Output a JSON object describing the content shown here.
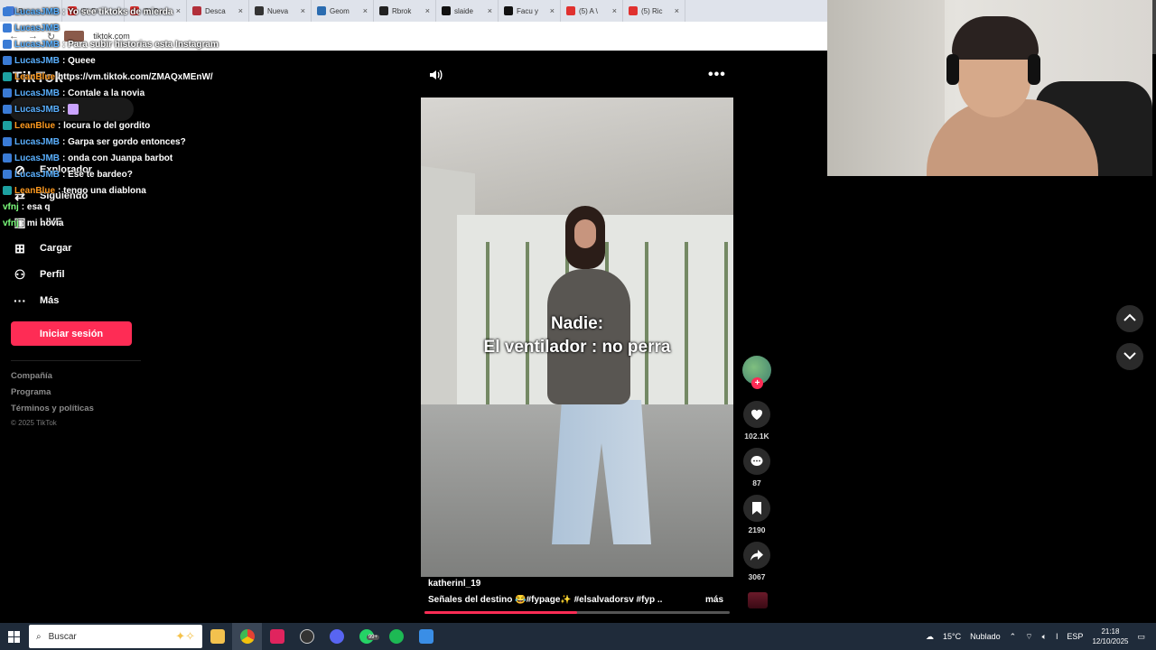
{
  "browser": {
    "tabs": [
      {
        "label": "Re",
        "color": "#4a7bd8"
      },
      {
        "label": "(5) El",
        "color": "#e0312f"
      },
      {
        "label": "(5) Pri",
        "color": "#e0312f"
      },
      {
        "label": "Desca",
        "color": "#b22f3a"
      },
      {
        "label": "Nueva",
        "color": "#333333"
      },
      {
        "label": "Geom",
        "color": "#2b6cb0"
      },
      {
        "label": "Rbrok",
        "color": "#222222"
      },
      {
        "label": "slaide",
        "color": "#111111"
      },
      {
        "label": "Facu y",
        "color": "#111111"
      },
      {
        "label": "(5) A \\",
        "color": "#e0312f"
      },
      {
        "label": "(5) Ric",
        "color": "#e0312f"
      }
    ],
    "close_glyph": "×",
    "url": "tiktok.com"
  },
  "tiktok": {
    "logo": "TikTok",
    "nav": [
      {
        "label": "Explorador",
        "icon": "compass-icon",
        "glyph": "⊘"
      },
      {
        "label": "Siguiendo",
        "icon": "following-icon",
        "glyph": "⇄"
      },
      {
        "label": "LIVE",
        "icon": "live-icon",
        "glyph": "▣"
      },
      {
        "label": "Cargar",
        "icon": "upload-icon",
        "glyph": "⊞"
      },
      {
        "label": "Perfil",
        "icon": "profile-icon",
        "glyph": "⚇"
      },
      {
        "label": "Más",
        "icon": "more-icon",
        "glyph": "···"
      }
    ],
    "login_button": "Iniciar sesión",
    "footer_links": [
      "Compañía",
      "Programa",
      "Términos y políticas"
    ],
    "copyright": "© 2025 TikTok"
  },
  "chat": {
    "messages": [
      {
        "user": "LucasJMB",
        "text": ": Yo see tiktoks de mierda"
      },
      {
        "user": "LucasJMB",
        "text": ""
      },
      {
        "user": "LucasJMB",
        "text": ": Para subir historias esta Instagram"
      },
      {
        "user": "LucasJMB",
        "text": ": Queee"
      },
      {
        "user": "LeanBlue",
        "text": "https://vm.tiktok.com/ZMAQxMEnW/"
      },
      {
        "user": "LucasJMB",
        "text": ": Contale a la novia"
      },
      {
        "user": "LucasJMB",
        "text": ":"
      },
      {
        "user": "LeanBlue",
        "text": ": locura lo del gordito"
      },
      {
        "user": "LucasJMB",
        "text": ": Garpa ser gordo entonces?"
      },
      {
        "user": "LucasJMB",
        "text": ":   onda con Juanpa barbot"
      },
      {
        "user": "LucasJMB",
        "text": ": Ese te bardeo?"
      },
      {
        "user": "LeanBlue",
        "text": ":       tengo una diablona"
      },
      {
        "user": "vfnj",
        "text": ": esa q"
      },
      {
        "user": "vfnj",
        "text": ": mi novia"
      }
    ]
  },
  "video": {
    "overlay_line1": "Nadie:",
    "overlay_line2": "El ventilador : no perra",
    "author": "katherinl_19",
    "caption": "Señales del destino 😂#fypage✨ #elsalvadorsv #fyp ...",
    "more_label": "más",
    "progress": 0.5,
    "likes": "102.1K",
    "comments": "87",
    "saves": "2190",
    "shares": "3067"
  },
  "taskbar": {
    "search_placeholder": "Buscar",
    "weather_temp": "15°C",
    "weather_desc": "Nublado",
    "language": "ESP",
    "time": "21:18",
    "date": "12/10/2025",
    "whatsapp_badge": "99+"
  },
  "colors": {
    "accent": "#fe2c55",
    "taskbar": "#1f2b3a"
  }
}
